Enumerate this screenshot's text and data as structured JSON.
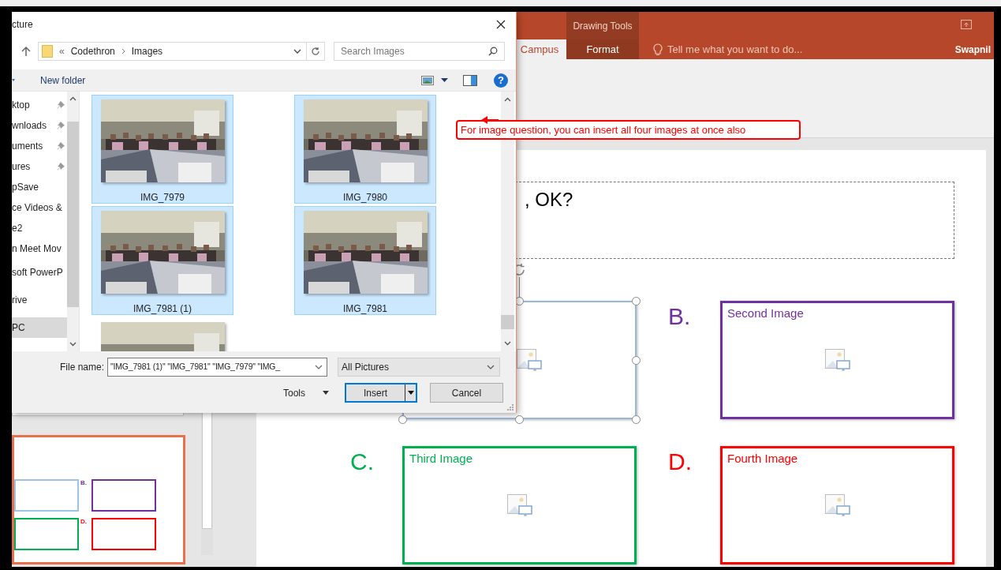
{
  "ribbon": {
    "contextual_group": "Drawing Tools",
    "tabs": [
      {
        "label": "Campus",
        "selected": true,
        "contextual": false
      },
      {
        "label": "Format",
        "selected": false,
        "contextual": true
      }
    ],
    "tell_me": "Tell me what you want to do...",
    "user": "Swapnil"
  },
  "dialog": {
    "title": "cture",
    "path_overflow": "«",
    "path": [
      "Codethron",
      "Images"
    ],
    "search": {
      "placeholder": "Search Images"
    },
    "new_folder": "New folder",
    "help": "?",
    "nav_items": [
      {
        "label": "ktop",
        "pinned": true,
        "selected": false
      },
      {
        "label": "wnloads",
        "pinned": true,
        "selected": false
      },
      {
        "label": "uments",
        "pinned": true,
        "selected": false
      },
      {
        "label": "ures",
        "pinned": true,
        "selected": false
      },
      {
        "label": "pSave",
        "pinned": false,
        "selected": false
      },
      {
        "label": "ce Videos &",
        "pinned": false,
        "selected": false
      },
      {
        "label": "e2",
        "pinned": false,
        "selected": false
      },
      {
        "label": "n Meet Mov",
        "pinned": false,
        "selected": false
      },
      {
        "label": "soft PowerP",
        "pinned": false,
        "selected": false
      },
      {
        "label": "rive",
        "pinned": false,
        "selected": false
      },
      {
        "label": "PC",
        "pinned": false,
        "selected": true
      }
    ],
    "files": [
      {
        "name": "IMG_7979",
        "selected": true
      },
      {
        "name": "IMG_7980",
        "selected": true
      },
      {
        "name": "IMG_7981 (1)",
        "selected": true
      },
      {
        "name": "IMG_7981",
        "selected": true
      },
      {
        "selected": false
      }
    ],
    "file_name": {
      "label": "File name:",
      "value": "\"IMG_7981 (1)\" \"IMG_7981\" \"IMG_7979\" \"IMG_"
    },
    "file_type": "All Pictures",
    "tools": "Tools",
    "insert": "Insert",
    "cancel": "Cancel"
  },
  "callout": "For image question, you can insert all four images at once also",
  "slide": {
    "title": ", OK?",
    "options": [
      {
        "color": "#9bb7d9",
        "selected": true
      },
      {
        "letter": "B.",
        "caption": "Second Image",
        "color": "#7030a0",
        "selected": false
      },
      {
        "letter": "C.",
        "caption": "Third Image",
        "color": "#00b050",
        "selected": false
      },
      {
        "letter": "D.",
        "caption": "Fourth Image",
        "color": "#ff0000",
        "selected": false
      }
    ]
  },
  "thumbnail": {
    "selected": true,
    "options": [
      {
        "color": "#9dc3e6"
      },
      {
        "letter": "B.",
        "color": "#7030a0"
      },
      {
        "color": "#00b050"
      },
      {
        "letter": "D.",
        "color": "#ff0000"
      }
    ]
  }
}
